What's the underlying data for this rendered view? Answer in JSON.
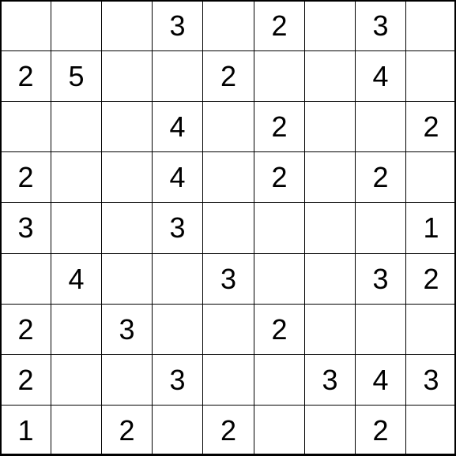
{
  "grid": {
    "rows": 9,
    "cols": 9,
    "cell_size": 63.9,
    "values": [
      [
        "",
        "",
        "",
        "3",
        "",
        "2",
        "",
        "3",
        ""
      ],
      [
        "2",
        "5",
        "",
        "",
        "2",
        "",
        "",
        "4",
        ""
      ],
      [
        "",
        "",
        "",
        "4",
        "",
        "2",
        "",
        "",
        "2"
      ],
      [
        "2",
        "",
        "",
        "4",
        "",
        "2",
        "",
        "2",
        ""
      ],
      [
        "3",
        "",
        "",
        "3",
        "",
        "",
        "",
        "",
        "1"
      ],
      [
        "",
        "4",
        "",
        "",
        "3",
        "",
        "",
        "3",
        "2"
      ],
      [
        "2",
        "",
        "3",
        "",
        "",
        "2",
        "",
        "",
        ""
      ],
      [
        "2",
        "",
        "",
        "3",
        "",
        "",
        "3",
        "4",
        "3"
      ],
      [
        "1",
        "",
        "2",
        "",
        "2",
        "",
        "",
        "2",
        ""
      ]
    ]
  },
  "chart_data": {
    "type": "table",
    "title": "",
    "rows": 9,
    "cols": 9,
    "cells": [
      [
        "",
        "",
        "",
        "3",
        "",
        "2",
        "",
        "3",
        ""
      ],
      [
        "2",
        "5",
        "",
        "",
        "2",
        "",
        "",
        "4",
        ""
      ],
      [
        "",
        "",
        "",
        "4",
        "",
        "2",
        "",
        "",
        "2"
      ],
      [
        "2",
        "",
        "",
        "4",
        "",
        "2",
        "",
        "2",
        ""
      ],
      [
        "3",
        "",
        "",
        "3",
        "",
        "",
        "",
        "",
        "1"
      ],
      [
        "",
        "4",
        "",
        "",
        "3",
        "",
        "",
        "3",
        "2"
      ],
      [
        "2",
        "",
        "3",
        "",
        "",
        "2",
        "",
        "",
        ""
      ],
      [
        "2",
        "",
        "",
        "3",
        "",
        "",
        "3",
        "4",
        "3"
      ],
      [
        "1",
        "",
        "2",
        "",
        "2",
        "",
        "",
        "2",
        ""
      ]
    ]
  }
}
